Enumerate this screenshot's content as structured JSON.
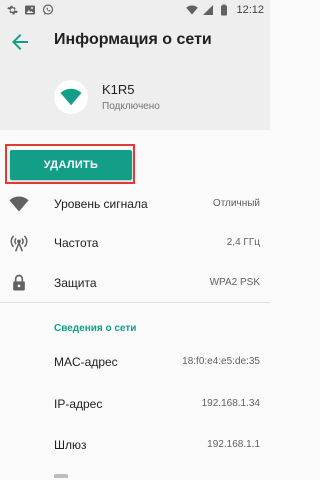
{
  "status_bar": {
    "time": "12:12",
    "left_icons": [
      "settings-gear-icon",
      "image-gallery-icon",
      "whatsapp-icon"
    ],
    "right_icons": [
      "wifi-signal-icon",
      "cellular-signal-icon",
      "battery-icon"
    ]
  },
  "appbar": {
    "back_icon": "arrow-back-icon",
    "title": "Информация о сети"
  },
  "network": {
    "icon": "wifi-icon",
    "name": "K1R5",
    "status": "Подключено"
  },
  "actions": {
    "delete_label": "УДАЛИТЬ"
  },
  "details": [
    {
      "icon": "wifi-strength-icon",
      "label": "Уровень сигнала",
      "value": "Отличный"
    },
    {
      "icon": "frequency-icon",
      "label": "Частота",
      "value": "2,4 ГГц"
    },
    {
      "icon": "lock-icon",
      "label": "Защита",
      "value": "WPA2 PSK"
    }
  ],
  "network_info": {
    "title": "Сведения о сети",
    "rows": [
      {
        "label": "MAC-адрес",
        "value": "18:f0:e4:e5:de:35"
      },
      {
        "label": "IP-адрес",
        "value": "192.168.1.34"
      },
      {
        "label": "Шлюз",
        "value": "192.168.1.1"
      }
    ]
  },
  "colors": {
    "accent": "#129e87",
    "header_bg": "#eeeeee",
    "highlight_frame": "#e53935"
  }
}
